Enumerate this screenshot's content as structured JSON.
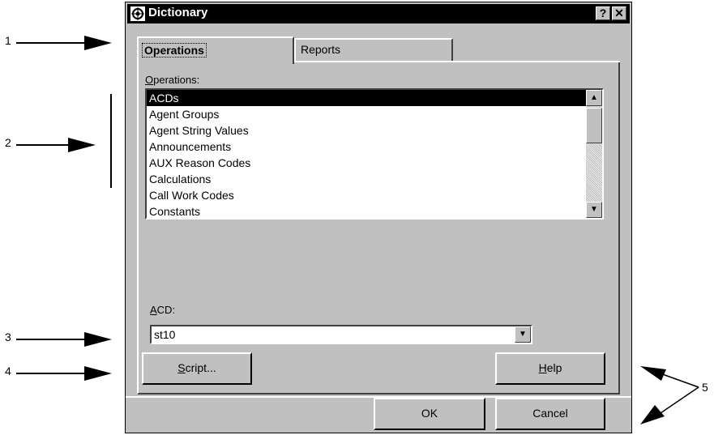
{
  "window": {
    "title": "Dictionary",
    "help_glyph": "?",
    "close_glyph": "✕",
    "icon": "dictionary-app-icon"
  },
  "tabs": [
    {
      "label": "Operations",
      "active": true
    },
    {
      "label": "Reports",
      "active": false
    }
  ],
  "operations_label_underlined": "O",
  "operations_label_rest": "perations:",
  "operations_list": [
    "ACDs",
    "Agent Groups",
    "Agent String Values",
    "Announcements",
    "AUX Reason Codes",
    "Calculations",
    "Call Work Codes",
    "Constants"
  ],
  "selected_item": "ACDs",
  "acd_label_underlined": "A",
  "acd_label_rest": "CD:",
  "acd_value": "st10",
  "buttons": {
    "script_underlined": "S",
    "script_rest": "cript...",
    "help_underlined": "H",
    "help_rest": "elp",
    "ok": "OK",
    "cancel": "Cancel"
  },
  "callouts": {
    "c1": "1",
    "c2": "2",
    "c3": "3",
    "c4": "4",
    "c5": "5"
  }
}
